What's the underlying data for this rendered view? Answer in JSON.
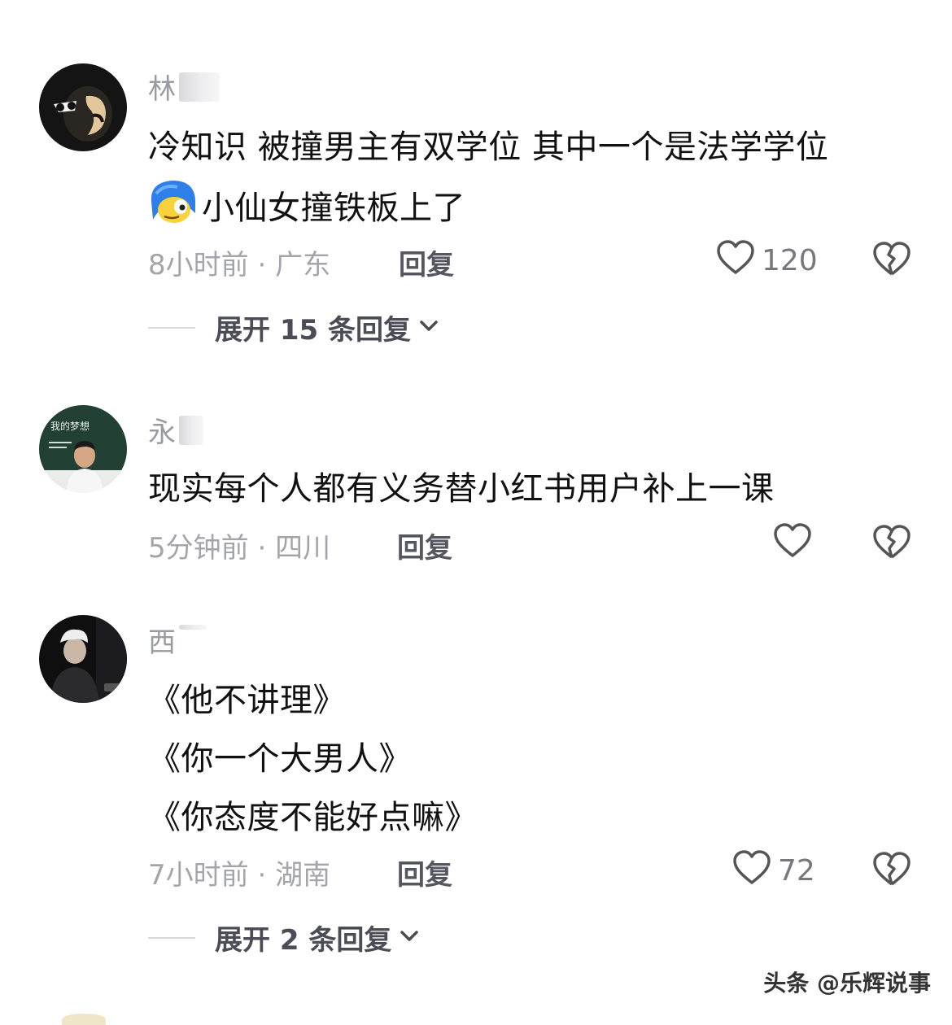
{
  "comments": [
    {
      "username": "林",
      "body_lines": [
        "冷知识 被撞男主有双学位 其中一个是法学学位",
        "小仙女撞铁板上了"
      ],
      "time": "8小时前",
      "location": "广东",
      "reply_label": "回复",
      "likes": "120",
      "expand_label": "展开 15 条回复"
    },
    {
      "username": "永",
      "body_lines": [
        "现实每个人都有义务替小红书用户补上一课"
      ],
      "time": "5分钟前",
      "location": "四川",
      "reply_label": "回复",
      "likes": ""
    },
    {
      "username": "西",
      "body_lines": [
        "《他不讲理》",
        "《你一个大男人》",
        "《你态度不能好点嘛》"
      ],
      "time": "7小时前",
      "location": "湖南",
      "reply_label": "回复",
      "likes": "72",
      "expand_label": "展开 2 条回复"
    }
  ],
  "meta_separator": "·",
  "avatar2_board_text": "我的梦想",
  "watermark": "头条 @乐辉说事",
  "colors": {
    "text": "#111111",
    "muted": "#a4a5aa",
    "icon": "#555555"
  }
}
